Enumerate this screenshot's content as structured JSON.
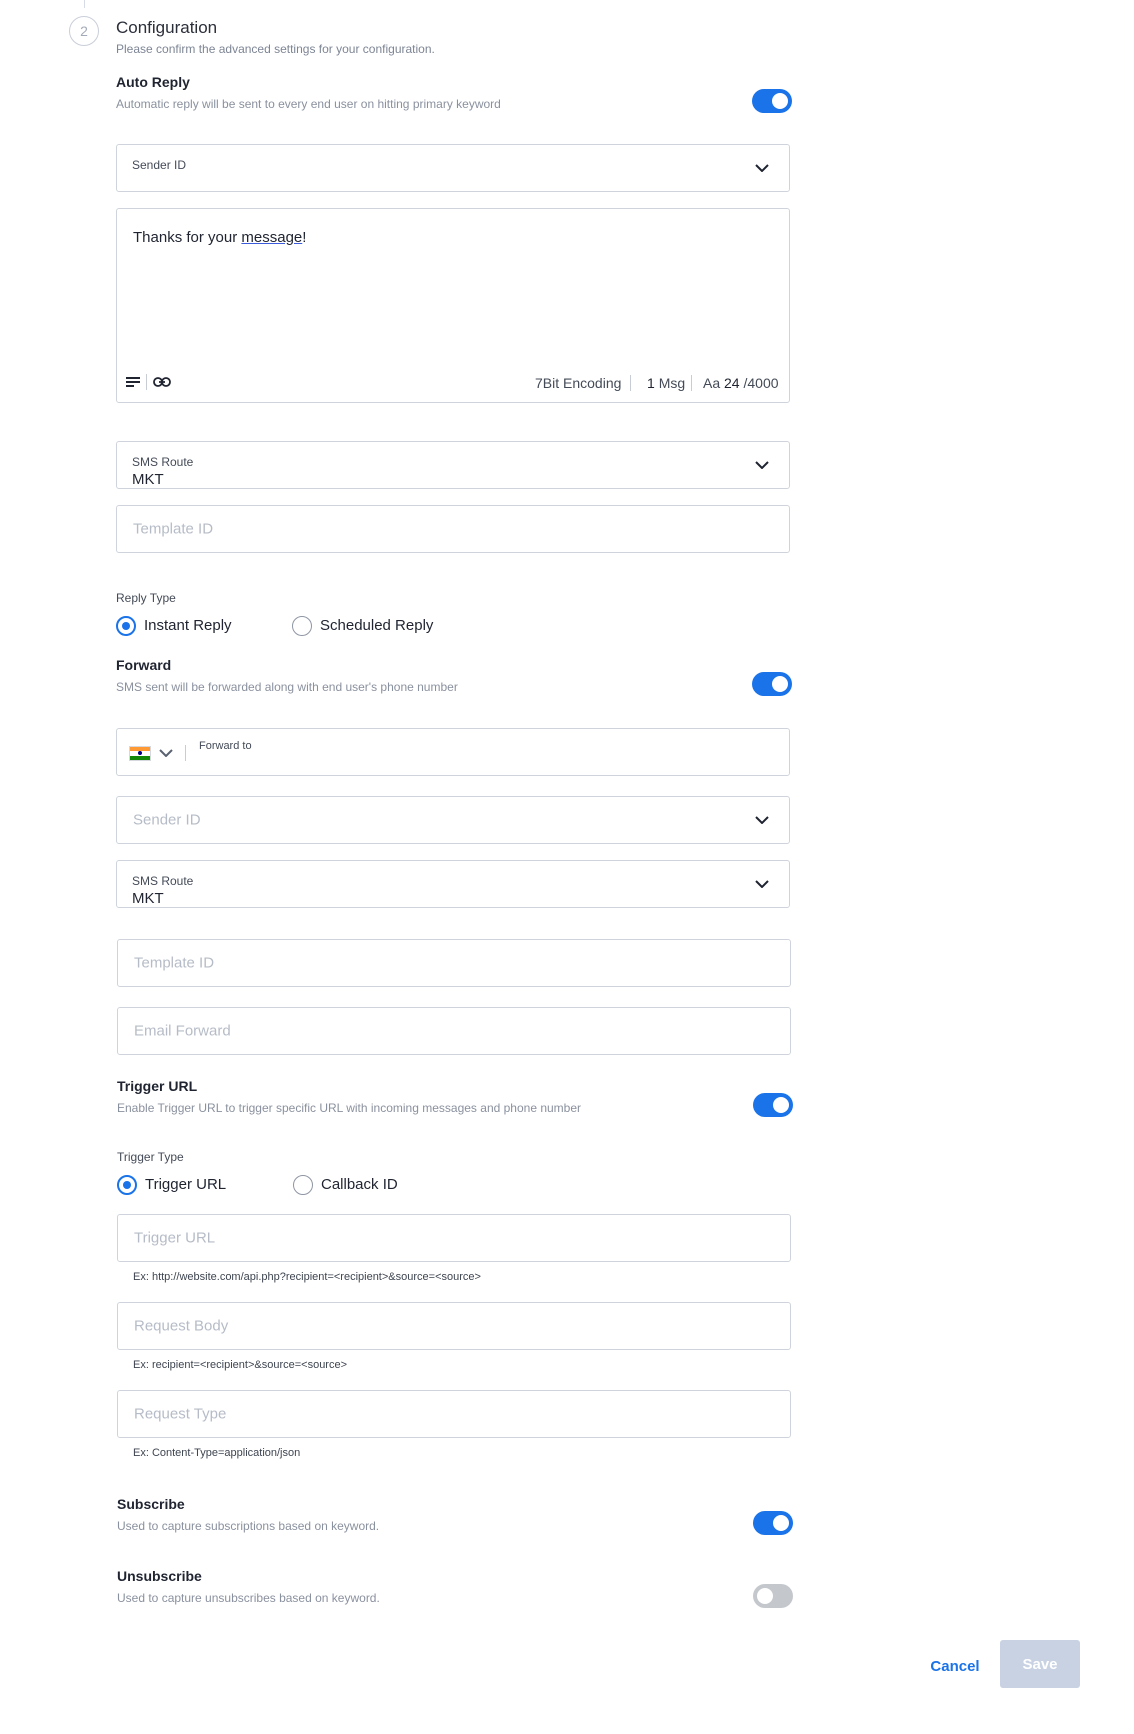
{
  "step": {
    "number": "2",
    "title": "Configuration",
    "subtitle": "Please confirm the advanced settings for your configuration."
  },
  "auto_reply": {
    "title": "Auto Reply",
    "description": "Automatic reply will be sent to every end user on hitting primary keyword",
    "enabled": true,
    "sender_id_label": "Sender ID",
    "message_text": "Thanks for your ",
    "message_text_underlined": "message",
    "message_text_end": "!",
    "encoding": "7Bit Encoding",
    "msg_count_num": "1",
    "msg_count_label": "Msg",
    "aa_label": "Aa",
    "char_count": "24",
    "char_limit": "/4000",
    "sms_route_label": "SMS Route",
    "sms_route_value": "MKT",
    "template_id_placeholder": "Template ID"
  },
  "reply_type": {
    "label": "Reply Type",
    "options": [
      "Instant Reply",
      "Scheduled Reply"
    ],
    "selected": "Instant Reply"
  },
  "forward": {
    "title": "Forward",
    "description": "SMS sent will be forwarded along with end user's phone number",
    "enabled": true,
    "forward_to_label": "Forward to",
    "sender_id_placeholder": "Sender ID",
    "sms_route_label": "SMS Route",
    "sms_route_value": "MKT",
    "template_id_placeholder": "Template ID",
    "email_forward_placeholder": "Email Forward"
  },
  "trigger_url": {
    "title": "Trigger URL",
    "description": "Enable Trigger URL to trigger specific URL with incoming messages and phone number",
    "enabled": true,
    "type_label": "Trigger Type",
    "options": [
      "Trigger URL",
      "Callback ID"
    ],
    "selected": "Trigger URL",
    "url_placeholder": "Trigger URL",
    "url_example": "Ex: http://website.com/api.php?recipient=<recipient>&source=<source>",
    "body_placeholder": "Request Body",
    "body_example": "Ex: recipient=<recipient>&source=<source>",
    "type_placeholder": "Request Type",
    "type_example": "Ex: Content-Type=application/json"
  },
  "subscribe": {
    "title": "Subscribe",
    "description": "Used to capture subscriptions based on keyword.",
    "enabled": true
  },
  "unsubscribe": {
    "title": "Unsubscribe",
    "description": "Used to capture unsubscribes based on keyword.",
    "enabled": false
  },
  "actions": {
    "cancel_label": "Cancel",
    "save_label": "Save"
  },
  "colors": {
    "accent": "#1a73e8",
    "toggle_off": "#c4c7cc",
    "save_disabled": "#c8d2e3"
  },
  "icons": {
    "format": "text-format-icon",
    "link": "link-icon",
    "chevron": "chevron-down-icon",
    "flag": "india-flag-icon"
  }
}
